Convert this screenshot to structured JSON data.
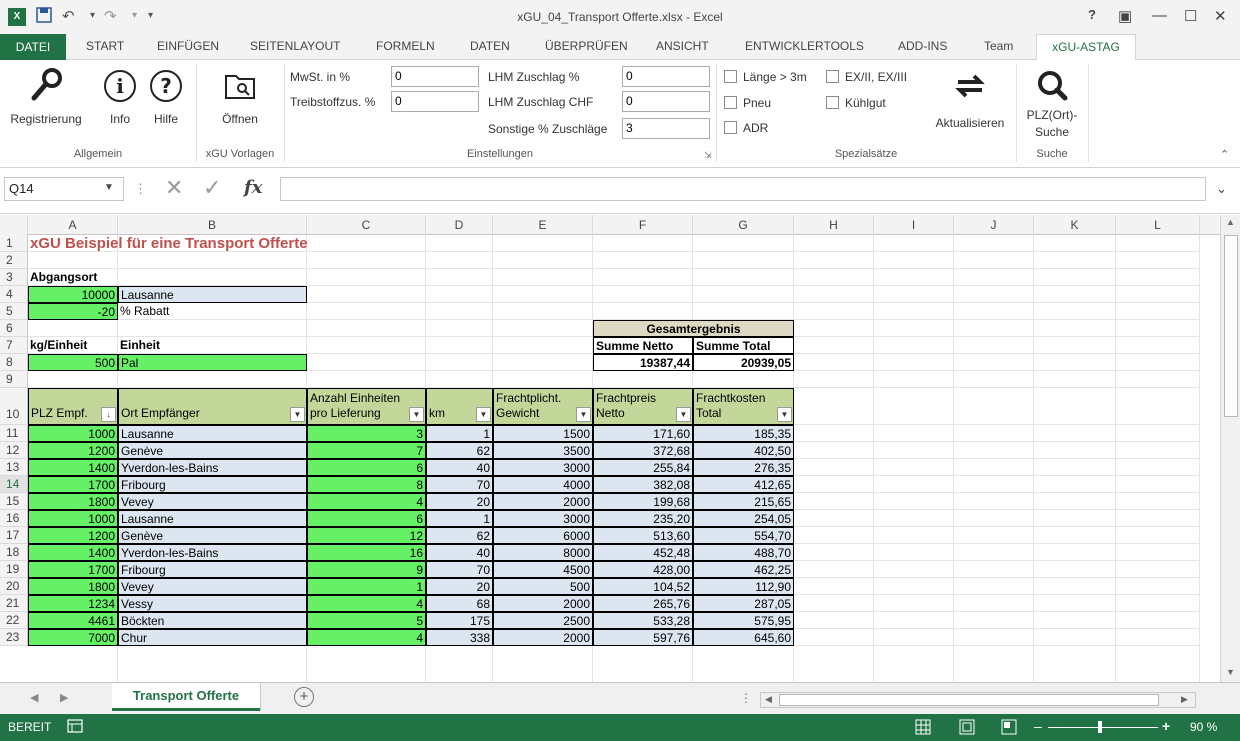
{
  "window": {
    "title": "xGU_04_Transport Offerte.xlsx - Excel",
    "logo": "X",
    "help": "?",
    "controls": [
      "▣",
      "—",
      "☐",
      "✕"
    ]
  },
  "tabs": {
    "file": "DATEI",
    "items": [
      "START",
      "EINFÜGEN",
      "SEITENLAYOUT",
      "FORMELN",
      "DATEN",
      "ÜBERPRÜFEN",
      "ANSICHT",
      "ENTWICKLERTOOLS",
      "ADD-INS",
      "Team"
    ],
    "active": "xGU-ASTAG"
  },
  "ribbon": {
    "buttons": {
      "registrierung": "Registrierung",
      "info": "Info",
      "hilfe": "Hilfe",
      "oeffnen": "Öffnen",
      "aktualisieren": "Aktualisieren",
      "plz_suche_1": "PLZ(Ort)-",
      "plz_suche_2": "Suche"
    },
    "groups": {
      "allgemein": "Allgemein",
      "vorlagen": "xGU Vorlagen",
      "einstellungen": "Einstellungen",
      "spezialsaetze": "Spezialsätze",
      "suche": "Suche"
    },
    "settings": {
      "mwst_label": "MwSt. in %",
      "mwst_value": "0",
      "treib_label": "Treibstoffzus. %",
      "treib_value": "0",
      "lhm_pct_label": "LHM Zuschlag %",
      "lhm_pct_value": "0",
      "lhm_chf_label": "LHM Zuschlag CHF",
      "lhm_chf_value": "0",
      "sonstige_label": "Sonstige % Zuschläge",
      "sonstige_value": "3"
    },
    "checkboxes": {
      "laenge": "Länge > 3m",
      "exii": "EX/II, EX/III",
      "pneu": "Pneu",
      "kuehlgut": "Kühlgut",
      "adr": "ADR"
    },
    "icons": {
      "registrierung": "key-icon",
      "info": "info-icon",
      "hilfe": "help-icon",
      "oeffnen": "folder-search-icon",
      "aktualisieren": "refresh-icon",
      "suche": "magnifier-icon"
    }
  },
  "formula_bar": {
    "name_box": "Q14",
    "fx": "fx",
    "content": ""
  },
  "columns": [
    "A",
    "B",
    "C",
    "D",
    "E",
    "F",
    "G",
    "H",
    "I",
    "J",
    "K",
    "L"
  ],
  "rows": [
    "1",
    "2",
    "3",
    "4",
    "5",
    "6",
    "7",
    "8",
    "9",
    "10",
    "11",
    "12",
    "13",
    "14",
    "15",
    "16",
    "17",
    "18",
    "19",
    "20",
    "21",
    "22",
    "23"
  ],
  "sheet": {
    "title": "xGU Beispiel für eine Transport Offerte",
    "abgangsort_label": "Abgangsort",
    "abgangsort_plz": "10000",
    "abgangsort_ort": "Lausanne",
    "rabatt_value": "-20",
    "rabatt_label": "% Rabatt",
    "kg_label": "kg/Einheit",
    "einheit_label": "Einheit",
    "kg_value": "500",
    "einheit_value": "Pal",
    "gesamt_title": "Gesamtergebnis",
    "summe_netto_label": "Summe Netto",
    "summe_total_label": "Summe Total",
    "summe_netto": "19387,44",
    "summe_total": "20939,05",
    "headers": {
      "a": "PLZ Empf.",
      "b": "Ort Empfänger",
      "c1": "Anzahl Einheiten",
      "c2": "pro Lieferung",
      "d": "km",
      "e1": "Frachtplicht.",
      "e2": "Gewicht",
      "f1": "Frachtpreis",
      "f2": "Netto",
      "g1": "Frachtkosten",
      "g2": "Total"
    },
    "data": [
      [
        "1000",
        "Lausanne",
        "3",
        "1",
        "1500",
        "171,60",
        "185,35"
      ],
      [
        "1200",
        "Genève",
        "7",
        "62",
        "3500",
        "372,68",
        "402,50"
      ],
      [
        "1400",
        "Yverdon-les-Bains",
        "6",
        "40",
        "3000",
        "255,84",
        "276,35"
      ],
      [
        "1700",
        "Fribourg",
        "8",
        "70",
        "4000",
        "382,08",
        "412,65"
      ],
      [
        "1800",
        "Vevey",
        "4",
        "20",
        "2000",
        "199,68",
        "215,65"
      ],
      [
        "1000",
        "Lausanne",
        "6",
        "1",
        "3000",
        "235,20",
        "254,05"
      ],
      [
        "1200",
        "Genève",
        "12",
        "62",
        "6000",
        "513,60",
        "554,70"
      ],
      [
        "1400",
        "Yverdon-les-Bains",
        "16",
        "40",
        "8000",
        "452,48",
        "488,70"
      ],
      [
        "1700",
        "Fribourg",
        "9",
        "70",
        "4500",
        "428,00",
        "462,25"
      ],
      [
        "1800",
        "Vevey",
        "1",
        "20",
        "500",
        "104,52",
        "112,90"
      ],
      [
        "1234",
        "Vessy",
        "4",
        "68",
        "2000",
        "265,76",
        "287,05"
      ],
      [
        "4461",
        "Böckten",
        "5",
        "175",
        "2500",
        "533,28",
        "575,95"
      ],
      [
        "7000",
        "Chur",
        "4",
        "338",
        "2000",
        "597,76",
        "645,60"
      ]
    ]
  },
  "sheet_tabs": {
    "active": "Transport Offerte",
    "add": "+"
  },
  "status": {
    "mode": "BEREIT",
    "zoom": "90 %"
  }
}
